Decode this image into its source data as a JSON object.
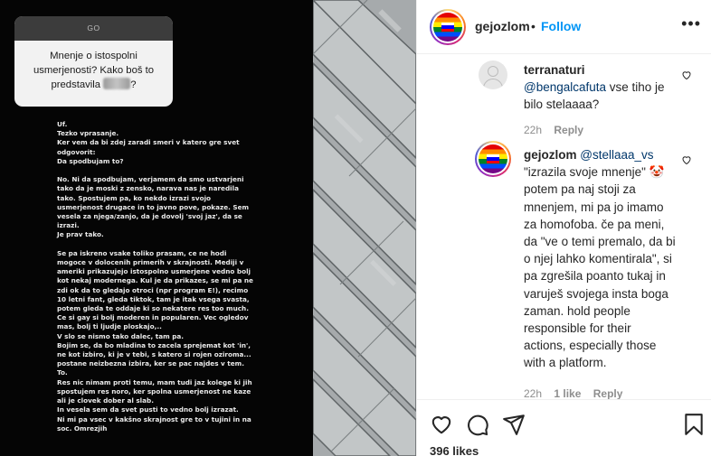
{
  "story": {
    "question_header": "GO",
    "question_text": "Mnenje o istospolni usmerjenosti? Kako boš to predstavila",
    "question_end": "?",
    "answer_text": "Uf.\nTezko vprasanje.\nKer vem da bi zdej zaradi smeri v katero gre svet\nodgovorit:\nDa spodbujam to?\n\nNo. Ni da spodbujam, verjamem da smo ustvarjeni\ntako da je moski z zensko, narava nas je naredila\ntako. Spostujem pa, ko nekdo izrazi svojo\nusmerjenost drugace in to javno pove, pokaze. Sem\nvesela za njega/zanjo, da je dovolj 'svoj jaz', da se\nizrazi.\nJe prav tako.\n\nSe pa iskreno vsake toliko prasam, ce ne hodi\nmogoce v dolocenih primerih v skrajnosti. Mediji v\nameriki prikazujejo istospolno usmerjene vedno bolj\nkot nekaj modernega. Kul je da prikazes, se mi pa ne\nzdi ok da to gledajo otroci (npr program E!), recimo\n10 letni fant, gleda tiktok, tam je itak vsega svasta,\npotem gleda te oddaje ki so nekatere res too much.\nCe si gay si bolj moderen in popularen. Vec ogledov\nmas, bolj ti ljudje ploskajo,..\nV slo se nismo tako dalec, tam pa.\nBojim se, da bo mladina to zacela sprejemat kot 'in',\nne kot izbiro, ki je v tebi, s katero si rojen oziroma...\npostane neizbezna izbira, ker se pac najdes v tem.\nTo.\nRes nic nimam proti temu, mam tudi jaz kolege ki jih\nspostujem res noro, ker spolna usmerjenost ne kaze\nali je clovek dober al slab.\nIn vesela sem da svet pusti to vedno bolj izrazat.\nNi mi pa vsec v kakšno skrajnost gre to v tujini in na\nsoc. Omrezjih"
  },
  "post": {
    "username": "gejozlom",
    "separator": "•",
    "follow_label": "Follow",
    "more_label": "•••",
    "likes": "396 likes"
  },
  "comments": [
    {
      "username": "terranaturi",
      "mention": "@bengalcafuta",
      "text": " vse tiho je bilo stelaaaa?",
      "time": "22h",
      "reply_label": "Reply"
    },
    {
      "username": "gejozlom",
      "mention": "@stellaaa_vs",
      "text": " \"izrazila svoje mnenje\" 🤡 potem pa naj stoji za mnenjem, mi pa jo imamo za homofoba. če pa meni, da \"ve o temi premalo, da bi o njej lahko komentirala\", si pa zgrešila poanto tukaj in varuješ svojega insta boga zaman. hold people responsible for their actions, especially those with a platform.",
      "time": "22h",
      "likes": "1 like",
      "reply_label": "Reply"
    }
  ],
  "icons": [
    "heart-icon",
    "comment-icon",
    "share-icon",
    "bookmark-icon",
    "more-icon"
  ],
  "colors": {
    "link": "#0095f6",
    "mention": "#00376b",
    "meta": "#8e8e8e",
    "text": "#262626"
  }
}
